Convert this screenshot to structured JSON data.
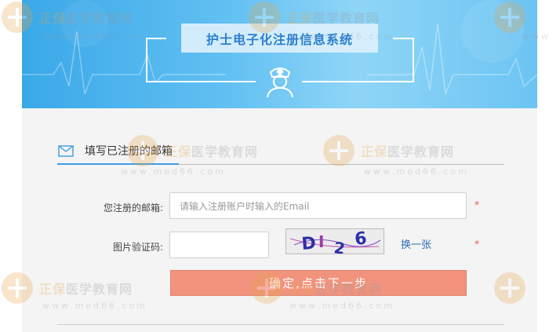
{
  "header": {
    "title": "护士电子化注册信息系统"
  },
  "section": {
    "title": "填写已注册的邮箱"
  },
  "form": {
    "email_label": "您注册的邮箱:",
    "email_placeholder": "请输入注册账户时输入的Email",
    "captcha_label": "图片验证码:",
    "captcha_value": "",
    "captcha_image_text": "DI26",
    "refresh_label": "换一张",
    "required_mark": "*",
    "submit_label": "确定,点击下一步"
  },
  "watermark": {
    "brand": "正保",
    "name": "医学教育网",
    "url": "www.med66.com"
  },
  "colors": {
    "banner": "#4fb6ef",
    "accent": "#3b9be0",
    "button": "#f2937e",
    "required": "#e65a4a",
    "link": "#2f6fb3"
  },
  "icons": {
    "section": "mail-icon",
    "banner": "nurse-icon"
  }
}
